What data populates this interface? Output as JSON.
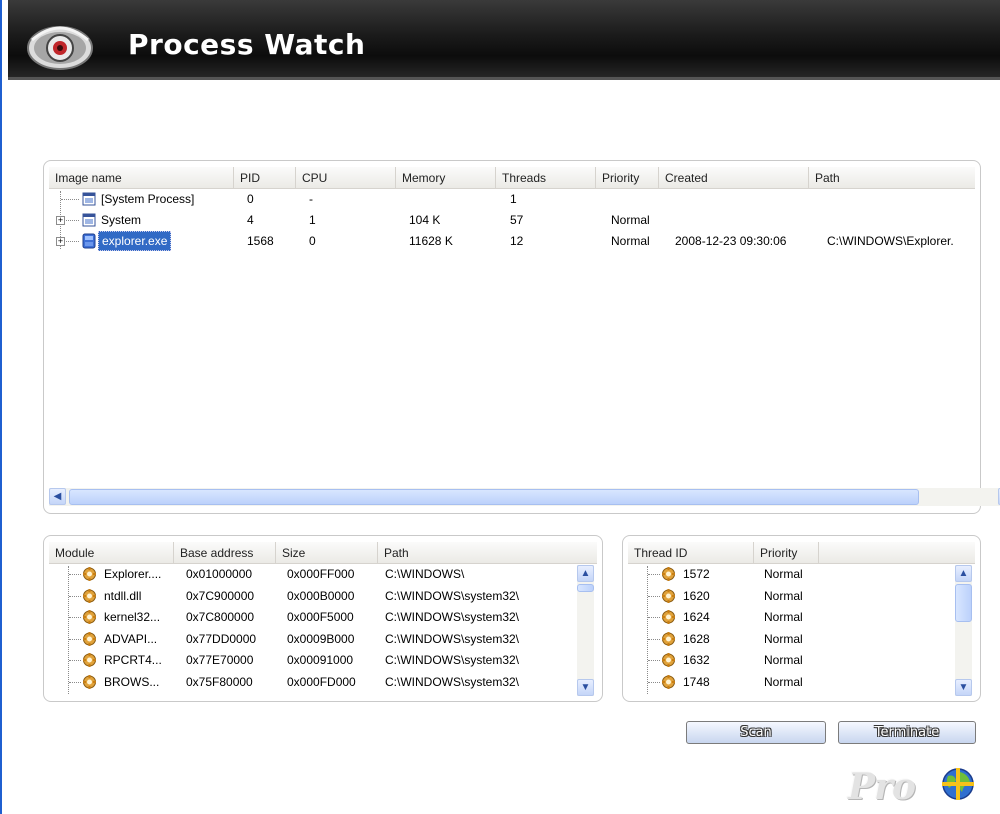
{
  "app": {
    "title": "Process Watch"
  },
  "processes": {
    "columns": [
      "Image name",
      "PID",
      "CPU",
      "Memory",
      "Threads",
      "Priority",
      "Created",
      "Path"
    ],
    "rows": [
      {
        "name": "[System Process]",
        "pid": "0",
        "cpu": "-",
        "memory": "",
        "threads": "1",
        "priority": "",
        "created": "",
        "path": "",
        "expandable": false,
        "selected": false
      },
      {
        "name": "System",
        "pid": "4",
        "cpu": "1",
        "memory": "104 K",
        "threads": "57",
        "priority": "Normal",
        "created": "",
        "path": "",
        "expandable": true,
        "selected": false
      },
      {
        "name": "explorer.exe",
        "pid": "1568",
        "cpu": "0",
        "memory": "11628 K",
        "threads": "12",
        "priority": "Normal",
        "created": "2008-12-23 09:30:06",
        "path": "C:\\WINDOWS\\Explorer.",
        "expandable": true,
        "selected": true
      }
    ]
  },
  "modules": {
    "columns": [
      "Module",
      "Base address",
      "Size",
      "Path"
    ],
    "rows": [
      {
        "module": "Explorer....",
        "base": "0x01000000",
        "size": "0x000FF000",
        "path": "C:\\WINDOWS\\"
      },
      {
        "module": "ntdll.dll",
        "base": "0x7C900000",
        "size": "0x000B0000",
        "path": "C:\\WINDOWS\\system32\\"
      },
      {
        "module": "kernel32...",
        "base": "0x7C800000",
        "size": "0x000F5000",
        "path": "C:\\WINDOWS\\system32\\"
      },
      {
        "module": "ADVAPI...",
        "base": "0x77DD0000",
        "size": "0x0009B000",
        "path": "C:\\WINDOWS\\system32\\"
      },
      {
        "module": "RPCRT4...",
        "base": "0x77E70000",
        "size": "0x00091000",
        "path": "C:\\WINDOWS\\system32\\"
      },
      {
        "module": "BROWS...",
        "base": "0x75F80000",
        "size": "0x000FD000",
        "path": "C:\\WINDOWS\\system32\\"
      }
    ]
  },
  "threads": {
    "columns": [
      "Thread ID",
      "Priority"
    ],
    "rows": [
      {
        "id": "1572",
        "priority": "Normal"
      },
      {
        "id": "1620",
        "priority": "Normal"
      },
      {
        "id": "1624",
        "priority": "Normal"
      },
      {
        "id": "1628",
        "priority": "Normal"
      },
      {
        "id": "1632",
        "priority": "Normal"
      },
      {
        "id": "1748",
        "priority": "Normal"
      }
    ]
  },
  "buttons": {
    "scan": "Scan",
    "terminate": "Terminate"
  },
  "branding": {
    "pro_label": "Pro"
  },
  "icons": {
    "app_logo": "eye-logo-icon",
    "process": "window-icon",
    "process_selected": "exe-icon",
    "module": "gear-module-icon",
    "thread": "gear-thread-icon",
    "globe": "globe-icon"
  },
  "colors": {
    "selection": "#316ac5",
    "title_bar": "#1a1a1a",
    "scroll_accent": "#c4d5f8"
  }
}
